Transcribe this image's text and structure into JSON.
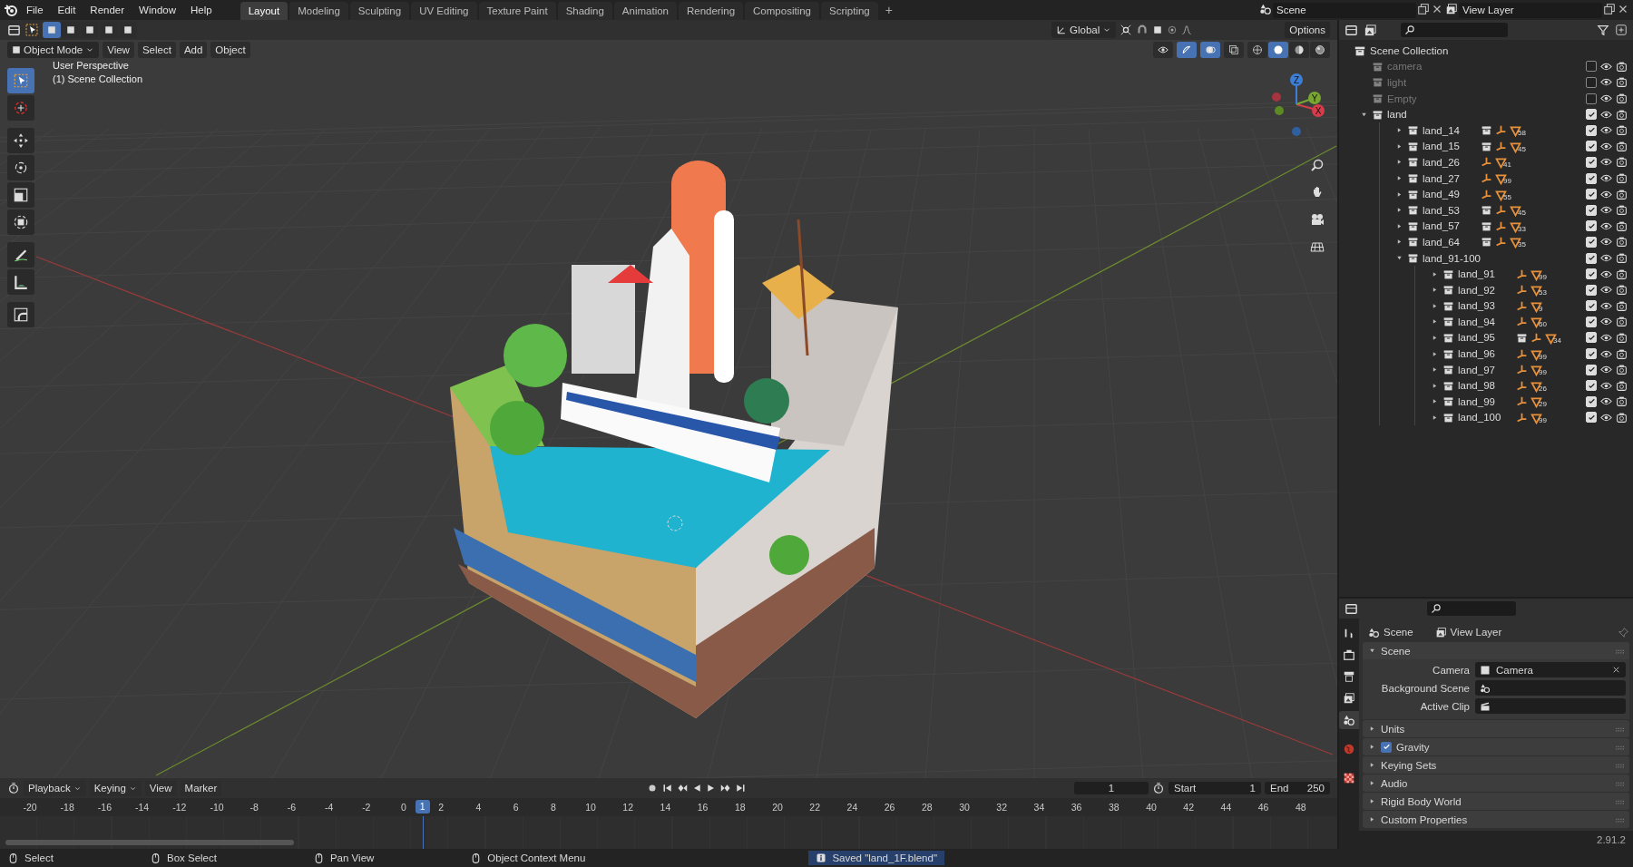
{
  "menu": [
    "File",
    "Edit",
    "Render",
    "Window",
    "Help"
  ],
  "workspaces": [
    {
      "label": "Layout",
      "selected": true
    },
    {
      "label": "Modeling",
      "selected": false
    },
    {
      "label": "Sculpting",
      "selected": false
    },
    {
      "label": "UV Editing",
      "selected": false
    },
    {
      "label": "Texture Paint",
      "selected": false
    },
    {
      "label": "Shading",
      "selected": false
    },
    {
      "label": "Animation",
      "selected": false
    },
    {
      "label": "Rendering",
      "selected": false
    },
    {
      "label": "Compositing",
      "selected": false
    },
    {
      "label": "Scripting",
      "selected": false
    }
  ],
  "add_workspace": "+",
  "scene_field": "Scene",
  "view_layer_field": "View Layer",
  "tool_header": {
    "select_modes": [
      {
        "selected": true
      },
      {
        "selected": false
      },
      {
        "selected": false
      },
      {
        "selected": false
      },
      {
        "selected": false
      }
    ],
    "orientation": "Global",
    "options": "Options"
  },
  "viewport_header": {
    "mode": "Object Mode",
    "menus": [
      "View",
      "Select",
      "Add",
      "Object"
    ],
    "toggles": [
      {
        "kind": "visibility",
        "on": false
      },
      {
        "kind": "gizmo",
        "on": true
      },
      {
        "kind": "overlay",
        "on": true
      },
      {
        "kind": "xray",
        "on": false
      }
    ],
    "shading_modes": [
      {
        "kind": "wireframe",
        "selected": false
      },
      {
        "kind": "solid",
        "selected": true
      },
      {
        "kind": "material",
        "selected": false
      },
      {
        "kind": "rendered",
        "selected": false
      }
    ]
  },
  "viewport": {
    "overlay_lines": [
      "User Perspective",
      "(1) Scene Collection"
    ],
    "gizmo_axes": [
      "Z",
      "Y",
      "X"
    ],
    "tools": [
      {
        "kind": "select",
        "selected": true
      },
      {
        "kind": "cursor",
        "selected": false
      },
      {
        "kind": "move",
        "selected": false
      },
      {
        "kind": "rotate",
        "selected": false
      },
      {
        "kind": "scale",
        "selected": false
      },
      {
        "kind": "transform",
        "selected": false
      },
      {
        "kind": "annotate",
        "selected": false
      },
      {
        "kind": "measure",
        "selected": false
      },
      {
        "kind": "shape",
        "selected": false
      }
    ]
  },
  "outliner": {
    "root": "Scene Collection",
    "items": [
      {
        "name": "camera",
        "checked": false
      },
      {
        "name": "light",
        "checked": false
      },
      {
        "name": "Empty",
        "checked": false
      },
      {
        "name": "land",
        "checked": true,
        "expanded": true,
        "children": [
          {
            "name": "land_14",
            "checked": true,
            "expanded": false,
            "extras": [
              {
                "kind": "collection"
              },
              {
                "kind": "armature"
              },
              {
                "kind": "mesh",
                "count": "58"
              }
            ]
          },
          {
            "name": "land_15",
            "checked": true,
            "expanded": false,
            "extras": [
              {
                "kind": "collection"
              },
              {
                "kind": "armature"
              },
              {
                "kind": "mesh",
                "count": "45"
              }
            ]
          },
          {
            "name": "land_26",
            "checked": true,
            "expanded": false,
            "extras": [
              {
                "kind": "armature"
              },
              {
                "kind": "mesh",
                "count": "41"
              }
            ]
          },
          {
            "name": "land_27",
            "checked": true,
            "expanded": false,
            "extras": [
              {
                "kind": "armature"
              },
              {
                "kind": "mesh",
                "count": "99"
              }
            ]
          },
          {
            "name": "land_49",
            "checked": true,
            "expanded": false,
            "extras": [
              {
                "kind": "armature"
              },
              {
                "kind": "mesh",
                "count": "55"
              }
            ]
          },
          {
            "name": "land_53",
            "checked": true,
            "expanded": false,
            "extras": [
              {
                "kind": "collection"
              },
              {
                "kind": "armature"
              },
              {
                "kind": "mesh",
                "count": "45"
              }
            ]
          },
          {
            "name": "land_57",
            "checked": true,
            "expanded": false,
            "extras": [
              {
                "kind": "collection"
              },
              {
                "kind": "armature"
              },
              {
                "kind": "mesh",
                "count": "33"
              }
            ]
          },
          {
            "name": "land_64",
            "checked": true,
            "expanded": false,
            "extras": [
              {
                "kind": "collection"
              },
              {
                "kind": "armature"
              },
              {
                "kind": "mesh",
                "count": "35"
              }
            ]
          },
          {
            "name": "land_91-100",
            "checked": true,
            "expanded": true,
            "children": [
              {
                "name": "land_91",
                "checked": true,
                "expanded": false,
                "extras": [
                  {
                    "kind": "armature"
                  },
                  {
                    "kind": "mesh",
                    "count": "99"
                  }
                ]
              },
              {
                "name": "land_92",
                "checked": true,
                "expanded": false,
                "extras": [
                  {
                    "kind": "armature"
                  },
                  {
                    "kind": "mesh",
                    "count": "53"
                  }
                ]
              },
              {
                "name": "land_93",
                "checked": true,
                "expanded": false,
                "extras": [
                  {
                    "kind": "armature"
                  },
                  {
                    "kind": "mesh",
                    "count": "9"
                  }
                ]
              },
              {
                "name": "land_94",
                "checked": true,
                "expanded": false,
                "extras": [
                  {
                    "kind": "armature"
                  },
                  {
                    "kind": "mesh",
                    "count": "60"
                  }
                ]
              },
              {
                "name": "land_95",
                "checked": true,
                "expanded": false,
                "extras": [
                  {
                    "kind": "collection"
                  },
                  {
                    "kind": "armature"
                  },
                  {
                    "kind": "mesh",
                    "count": "34"
                  }
                ]
              },
              {
                "name": "land_96",
                "checked": true,
                "expanded": false,
                "extras": [
                  {
                    "kind": "armature"
                  },
                  {
                    "kind": "mesh",
                    "count": "99"
                  }
                ]
              },
              {
                "name": "land_97",
                "checked": true,
                "expanded": false,
                "extras": [
                  {
                    "kind": "armature"
                  },
                  {
                    "kind": "mesh",
                    "count": "99"
                  }
                ]
              },
              {
                "name": "land_98",
                "checked": true,
                "expanded": false,
                "extras": [
                  {
                    "kind": "armature"
                  },
                  {
                    "kind": "mesh",
                    "count": "26"
                  }
                ]
              },
              {
                "name": "land_99",
                "checked": true,
                "expanded": false,
                "extras": [
                  {
                    "kind": "armature"
                  },
                  {
                    "kind": "mesh",
                    "count": "29"
                  }
                ]
              },
              {
                "name": "land_100",
                "checked": true,
                "expanded": false,
                "extras": [
                  {
                    "kind": "armature"
                  },
                  {
                    "kind": "mesh",
                    "count": "99"
                  }
                ]
              }
            ]
          }
        ]
      }
    ]
  },
  "properties": {
    "tabs": [
      {
        "kind": "tool",
        "selected": false
      },
      {
        "kind": "render",
        "selected": false
      },
      {
        "kind": "output",
        "selected": false
      },
      {
        "kind": "view_layer",
        "selected": false
      },
      {
        "kind": "scene",
        "selected": true
      },
      {
        "kind": "world",
        "selected": false
      },
      {
        "kind": "texture",
        "selected": false
      }
    ],
    "breadcrumb": [
      "Scene",
      "View Layer"
    ],
    "panels": [
      {
        "title": "Scene",
        "expanded": true,
        "fields": [
          {
            "label": "Camera",
            "value": "Camera"
          },
          {
            "label": "Background Scene"
          },
          {
            "label": "Active Clip"
          }
        ]
      },
      {
        "title": "Units",
        "expanded": false
      },
      {
        "title": "Gravity",
        "expanded": false,
        "checked": true
      },
      {
        "title": "Keying Sets",
        "expanded": false
      },
      {
        "title": "Audio",
        "expanded": false
      },
      {
        "title": "Rigid Body World",
        "expanded": false
      },
      {
        "title": "Custom Properties",
        "expanded": false
      }
    ],
    "version": "2.91.2"
  },
  "timeline": {
    "menus": [
      "Playback",
      "Keying",
      "View",
      "Marker"
    ],
    "current_frame": "1",
    "start_label": "Start",
    "start": "1",
    "end_label": "End",
    "end": "250",
    "ruler": [
      "-20",
      "-18",
      "-16",
      "-14",
      "-12",
      "-10",
      "-8",
      "-6",
      "-4",
      "-2",
      "0",
      "2",
      "4",
      "6",
      "8",
      "10",
      "12",
      "14",
      "16",
      "18",
      "20",
      "22",
      "24",
      "26",
      "28",
      "30",
      "32",
      "34",
      "36",
      "38",
      "40",
      "42",
      "44",
      "46",
      "48"
    ],
    "playhead": "1"
  },
  "status_bar": {
    "hints": [
      "Select",
      "Box Select",
      "Pan View",
      "Object Context Menu"
    ],
    "message": "Saved \"land_1F.blend\""
  }
}
